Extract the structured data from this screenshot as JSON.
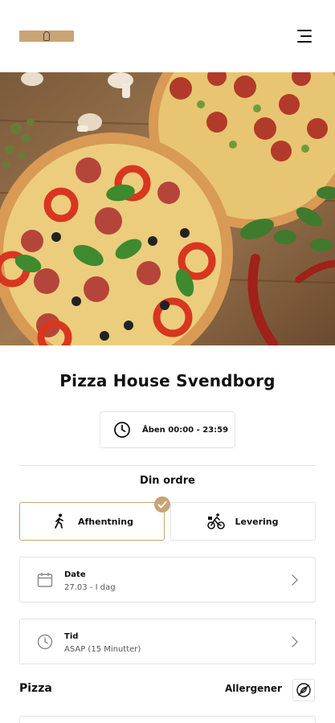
{
  "header": {
    "logo_icon": "pizza-house-logo",
    "menu_icon": "hamburger-menu-icon"
  },
  "hero": {
    "image": "pizzas-on-wooden-table"
  },
  "restaurant": {
    "name": "Pizza House Svendborg",
    "opening_hours": "Åben 00:00 - 23:59"
  },
  "order": {
    "title": "Din ordre",
    "options": [
      {
        "label": "Afhentning",
        "icon": "walking-person-icon",
        "selected": true
      },
      {
        "label": "Levering",
        "icon": "bicycle-delivery-icon",
        "selected": false
      }
    ],
    "date": {
      "label": "Date",
      "value": "27.03 - I dag"
    },
    "time": {
      "label": "Tid",
      "value": "ASAP (15 Minutter)"
    }
  },
  "menu": {
    "category": "Pizza",
    "allergens_label": "Allergener"
  },
  "colors": {
    "accent": "#c8a476",
    "border": "#e3e3e3",
    "text": "#111111"
  }
}
